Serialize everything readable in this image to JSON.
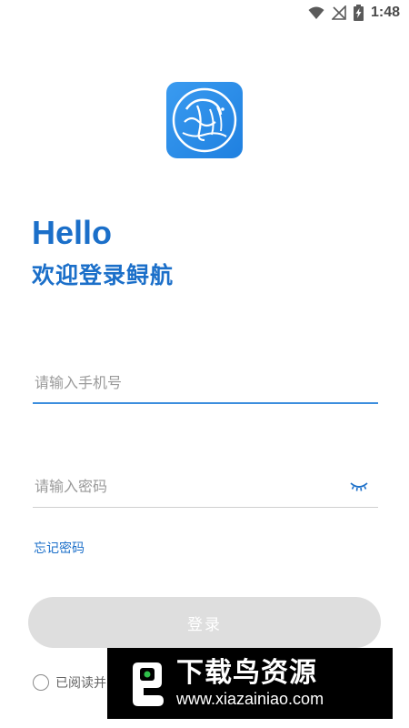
{
  "status_bar": {
    "time": "1:48",
    "icons": [
      "wifi-icon",
      "no-signal-icon",
      "battery-charging-icon"
    ]
  },
  "app": {
    "logo_icon": "app-logo-icon",
    "brand_color": "#1b6fc9"
  },
  "header": {
    "greeting": "Hello",
    "subtitle": "欢迎登录鲟航"
  },
  "form": {
    "phone_placeholder": "请输入手机号",
    "password_placeholder": "请输入密码",
    "password_toggle_icon": "eye-closed-icon",
    "forgot_label": "忘记密码",
    "login_label": "登录",
    "agree_prefix": "已阅读并"
  },
  "watermark": {
    "title": "下载鸟资源",
    "url": "www.xiazainiao.com"
  }
}
